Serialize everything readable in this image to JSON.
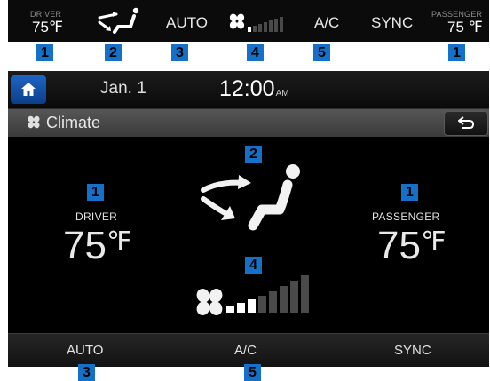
{
  "strip": {
    "driver_label": "DRIVER",
    "driver_temp": "75℉",
    "auto": "AUTO",
    "ac": "A/C",
    "sync": "SYNC",
    "passenger_label": "PASSENGER",
    "passenger_temp": "75 ℉",
    "fan_level": "1 of 7",
    "icons": [
      "seat-airflow-icon",
      "fan-icon"
    ]
  },
  "badges": {
    "b1": "1",
    "b2": "2",
    "b3": "3",
    "b4": "4",
    "b5": "5"
  },
  "screen": {
    "date": "Jan.  1",
    "time": "12:00",
    "ampm": "AM",
    "title": "Climate",
    "driver_label": "DRIVER",
    "driver_temp": "75",
    "passenger_label": "PASSENGER",
    "passenger_temp": "75",
    "temp_unit": "℉",
    "fan_level": "3 of 8",
    "buttons": {
      "auto": "AUTO",
      "ac": "A/C",
      "sync": "SYNC"
    },
    "icons": [
      "home-icon",
      "fan-icon",
      "back-arrow-icon",
      "seat-airflow-icon",
      "fan-icon"
    ]
  },
  "colors": {
    "badge": "#1570c8",
    "home_button": "#1d64c4",
    "fan_bar_active": "#ffffff",
    "fan_bar_inactive": "#4a4a4a"
  }
}
